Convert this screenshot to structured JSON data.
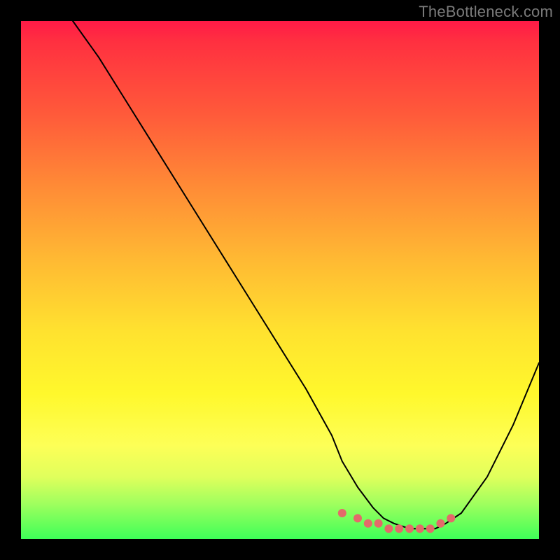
{
  "watermark": "TheBottleneck.com",
  "chart_data": {
    "type": "line",
    "title": "",
    "xlabel": "",
    "ylabel": "",
    "xlim": [
      0,
      100
    ],
    "ylim": [
      0,
      100
    ],
    "series": [
      {
        "name": "bottleneck-curve",
        "x": [
          10,
          15,
          20,
          25,
          30,
          35,
          40,
          45,
          50,
          55,
          60,
          62,
          65,
          68,
          70,
          72,
          75,
          78,
          80,
          82,
          85,
          90,
          95,
          100
        ],
        "y": [
          100,
          93,
          85,
          77,
          69,
          61,
          53,
          45,
          37,
          29,
          20,
          15,
          10,
          6,
          4,
          3,
          2,
          2,
          2,
          3,
          5,
          12,
          22,
          34
        ]
      }
    ],
    "highlight_points": {
      "name": "marker-dots",
      "color": "#e46a6a",
      "x": [
        62,
        65,
        67,
        69,
        71,
        73,
        75,
        77,
        79,
        81,
        83
      ],
      "y": [
        5,
        4,
        3,
        3,
        2,
        2,
        2,
        2,
        2,
        3,
        4
      ]
    }
  }
}
